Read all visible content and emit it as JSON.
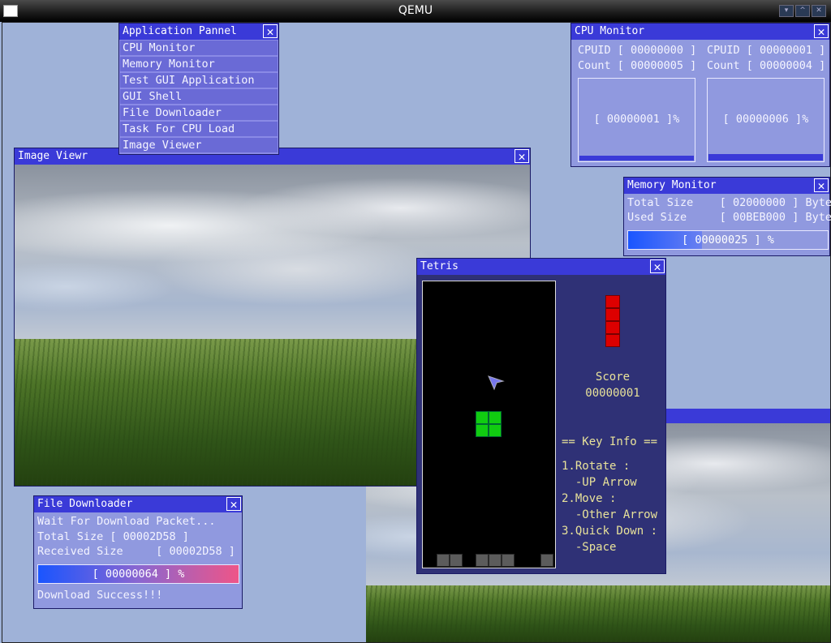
{
  "host": {
    "title": "QEMU"
  },
  "app_panel": {
    "title": "Application Pannel",
    "items": [
      "CPU Monitor",
      "Memory Monitor",
      "Test GUI Application",
      "GUI Shell",
      "File Downloader",
      "Task For CPU Load",
      "Image Viewer"
    ]
  },
  "image_viewer": {
    "title": "Image Viewr"
  },
  "cpu_monitor": {
    "title": "CPU Monitor",
    "cpus": [
      {
        "cpuid": "CPUID [ 00000000 ]",
        "count": "Count [ 00000005 ]",
        "load": "[ 00000001 ]%",
        "load_percent": 1
      },
      {
        "cpuid": "CPUID [ 00000001 ]",
        "count": "Count [ 00000004 ]",
        "load": "[ 00000006 ]%",
        "load_percent": 6
      }
    ]
  },
  "memory_monitor": {
    "title": "Memory Monitor",
    "total": "Total Size    [ 02000000 ] Byte",
    "used": "Used Size     [ 00BEB000 ] Byte",
    "percent_text": "[ 00000025 ] %",
    "percent": 37
  },
  "tetris": {
    "title": "Tetris",
    "score_label": "Score",
    "score": "00000001",
    "key_info_title": "== Key Info ==",
    "keys": [
      "1.Rotate :",
      "  -UP Arrow",
      "2.Move :",
      "  -Other Arrow",
      "3.Quick Down :",
      "  -Space"
    ],
    "colors": {
      "current_piece": "#11cc11",
      "next_piece": "#dd0000",
      "stack": "#5c5c5c"
    }
  },
  "file_downloader": {
    "title": "File Downloader",
    "status": "Wait For Download Packet...",
    "total": "Total Size [ 00002D58 ]",
    "received": "Received Size     [ 00002D58 ]",
    "percent_text": "[ 00000064 ] %",
    "percent": 100,
    "result": "Download Success!!!"
  },
  "colors": {
    "title_bar": "#3a3ad8",
    "window_body": "#9099df",
    "desktop": "#9fb2d8"
  }
}
